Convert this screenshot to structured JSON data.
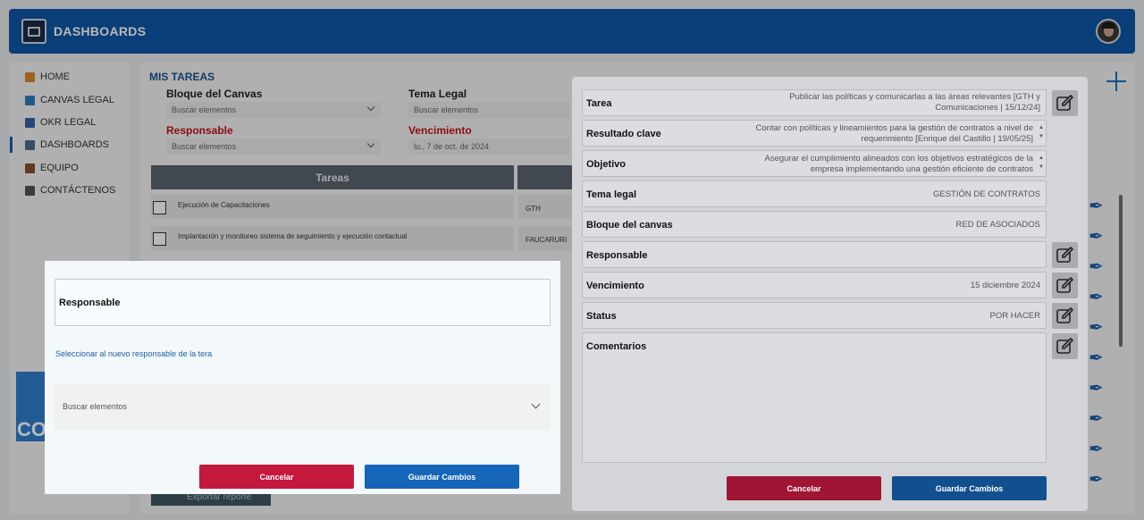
{
  "header": {
    "title": "DASHBOARDS"
  },
  "sidebar": {
    "items": [
      {
        "label": "HOME",
        "icon": "home-icon",
        "color": "#d98b2b"
      },
      {
        "label": "CANVAS LEGAL",
        "icon": "canvas-icon",
        "color": "#2f7fbf"
      },
      {
        "label": "OKR LEGAL",
        "icon": "chart-icon",
        "color": "#3464a8"
      },
      {
        "label": "DASHBOARDS",
        "icon": "dashboard-icon",
        "color": "#4a6a8a"
      },
      {
        "label": "EQUIPO",
        "icon": "briefcase-icon",
        "color": "#8a5030"
      },
      {
        "label": "CONTÁCTENOS",
        "icon": "headset-icon",
        "color": "#555555"
      }
    ],
    "card_text": "CO"
  },
  "main": {
    "title": "MIS TAREAS",
    "filters": {
      "bloque_label": "Bloque del Canvas",
      "bloque_placeholder": "Buscar elementos",
      "tema_label": "Tema Legal",
      "tema_placeholder": "Buscar elementos",
      "responsable_label": "Responsable",
      "responsable_placeholder": "Buscar elementos",
      "vencimiento_label": "Vencimiento",
      "vencimiento_value": "lu., 7 de oct. de 2024"
    },
    "table": {
      "header_tareas": "Tareas",
      "rows": [
        {
          "task": "Ejecución de Capacitaciones",
          "resp": "GTH"
        },
        {
          "task": "Implantación y monitoreo sistema de seguimiento y ejecución contactual",
          "resp": "FAUCARURI"
        }
      ]
    },
    "export_label": "Exportar reporte"
  },
  "modal_left": {
    "title": "Responsable",
    "hint": "Seleccionar al nuevo responsable de la tera",
    "select_placeholder": "Buscar elementos",
    "cancel_label": "Cancelar",
    "save_label": "Guardar Cambios"
  },
  "detail": {
    "tarea_label": "Tarea",
    "tarea_value": "Publicar las políticas y comunicarlas a las áreas relevantes [GTH y Comunicaciones | 15/12/24]",
    "resultado_label": "Resultado clave",
    "resultado_value": "Contar con políticas y lineamientos para la gestión de contratos a nivel de requerimiento [Enrique del Castillo | 19/05/25]",
    "objetivo_label": "Objetivo",
    "objetivo_value": "Asegurar el cumplimiento alineados con los objetivos estratégicos de la empresa implementando una gestión eficiente de contratos",
    "tema_label": "Tema legal",
    "tema_value": "GESTIÓN DE CONTRATOS",
    "bloque_label": "Bloque del canvas",
    "bloque_value": "RED DE ASOCIADOS",
    "responsable_label": "Responsable",
    "responsable_value": "",
    "vencimiento_label": "Vencimiento",
    "vencimiento_value": "15 diciembre 2024",
    "status_label": "Status",
    "status_value": "POR HACER",
    "comentarios_label": "Comentarios",
    "cancel_label": "Cancelar",
    "save_label": "Guardar Cambios"
  }
}
